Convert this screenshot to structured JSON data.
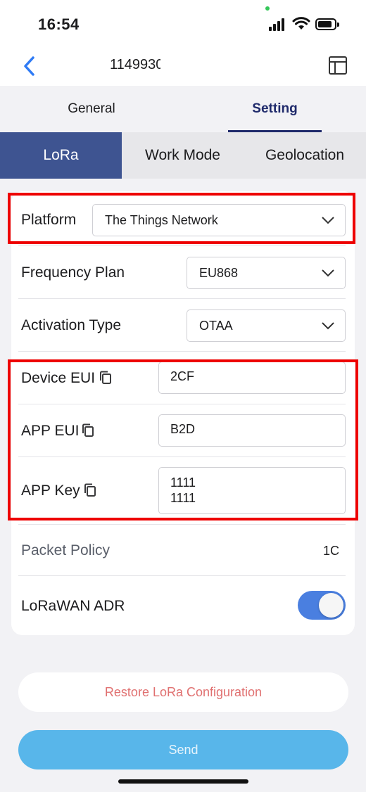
{
  "status_bar": {
    "time": "16:54"
  },
  "header": {
    "title": "1149930"
  },
  "top_tabs": [
    {
      "label": "General"
    },
    {
      "label": "Setting"
    }
  ],
  "sub_tabs": [
    {
      "label": "LoRa"
    },
    {
      "label": "Work Mode"
    },
    {
      "label": "Geolocation"
    }
  ],
  "form": {
    "platform": {
      "label": "Platform",
      "value": "The Things Network"
    },
    "frequency_plan": {
      "label": "Frequency Plan",
      "value": "EU868"
    },
    "activation_type": {
      "label": "Activation Type",
      "value": "OTAA"
    },
    "device_eui": {
      "label": "Device EUI",
      "value": "2CF"
    },
    "app_eui": {
      "label": "APP EUI",
      "value": "B2D"
    },
    "app_key": {
      "label": "APP Key",
      "value": "1111\n1111"
    },
    "packet_policy": {
      "label": "Packet Policy",
      "value": "1C"
    },
    "lorawan_adr": {
      "label": "LoRaWAN ADR",
      "enabled": true
    }
  },
  "buttons": {
    "restore": "Restore LoRa Configuration",
    "send": "Send"
  },
  "colors": {
    "accent": "#3e5491",
    "setting_tab": "#1f2a6b",
    "toggle_on": "#4a7fe0",
    "send_button": "#58b6ea",
    "restore_text": "#e07070",
    "highlight_box": "#ee0000"
  },
  "icons": {
    "back": "chevron-left-icon",
    "layout": "layout-icon",
    "dropdown": "chevron-down-icon",
    "copy": "copy-icon"
  }
}
